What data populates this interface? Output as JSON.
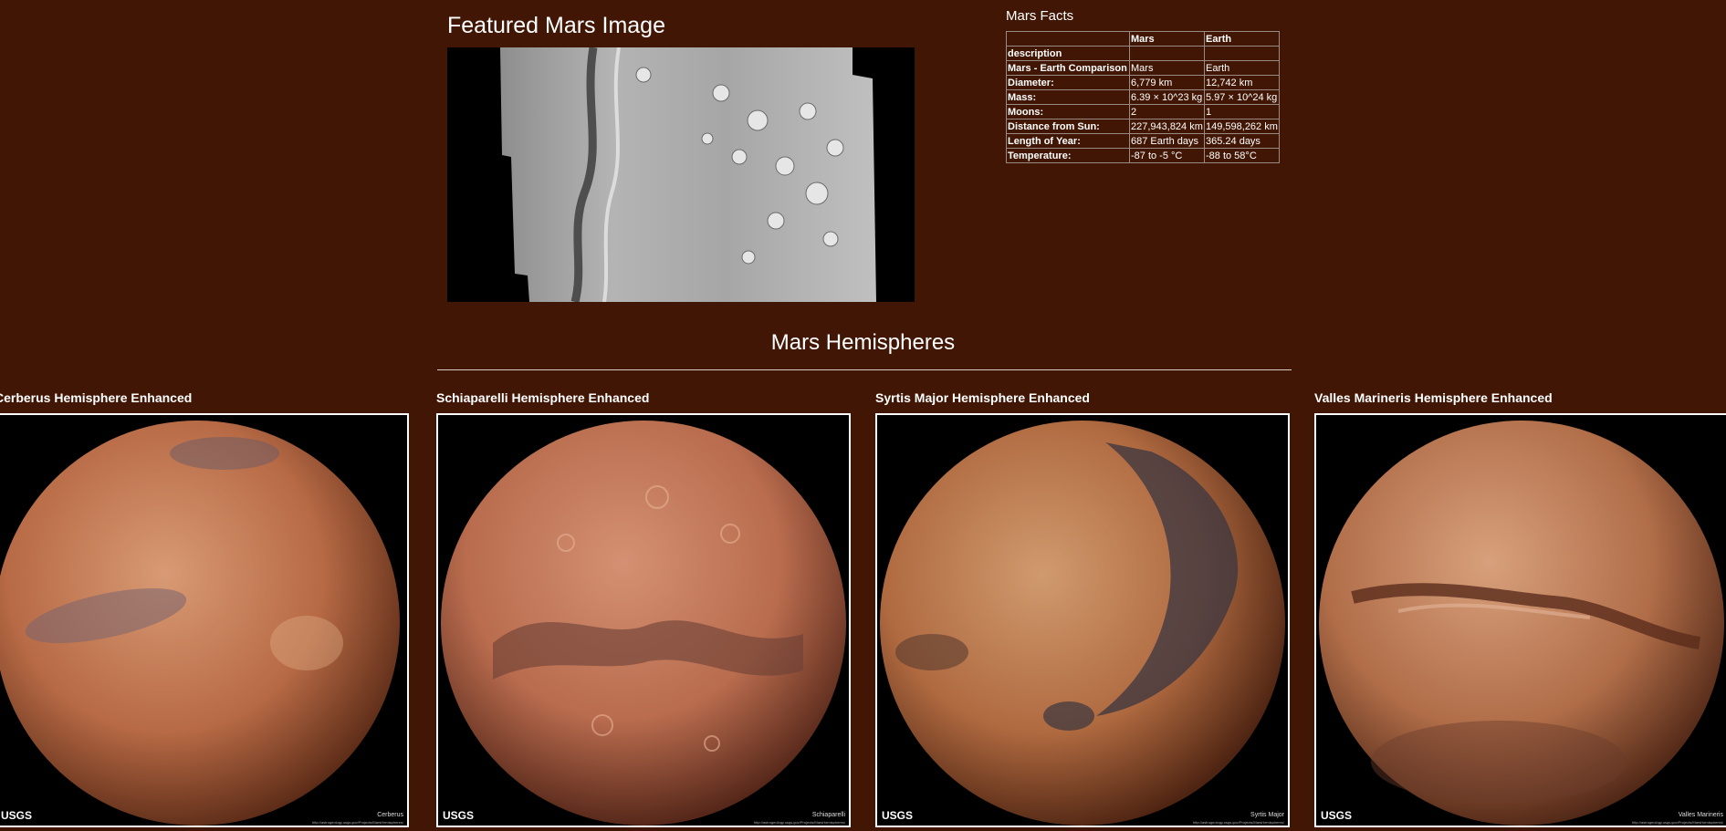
{
  "featured": {
    "title": "Featured Mars Image"
  },
  "facts": {
    "title": "Mars Facts",
    "headers": [
      "",
      "Mars",
      "Earth"
    ],
    "rows": [
      [
        "description",
        "",
        ""
      ],
      [
        "Mars - Earth Comparison",
        "Mars",
        "Earth"
      ],
      [
        "Diameter:",
        "6,779 km",
        "12,742 km"
      ],
      [
        "Mass:",
        "6.39 × 10^23 kg",
        "5.97 × 10^24 kg"
      ],
      [
        "Moons:",
        "2",
        "1"
      ],
      [
        "Distance from Sun:",
        "227,943,824 km",
        "149,598,262 km"
      ],
      [
        "Length of Year:",
        "687 Earth days",
        "365.24 days"
      ],
      [
        "Temperature:",
        "-87 to -5 °C",
        "-88 to 58°C"
      ]
    ]
  },
  "hemispheres": {
    "title": "Mars Hemispheres",
    "items": [
      {
        "name": "Cerberus Hemisphere Enhanced",
        "caption": "Cerberus"
      },
      {
        "name": "Schiaparelli Hemisphere Enhanced",
        "caption": "Schiaparelli"
      },
      {
        "name": "Syrtis Major Hemisphere Enhanced",
        "caption": "Syrtis Major"
      },
      {
        "name": "Valles Marineris Hemisphere Enhanced",
        "caption": "Valles Marineris"
      }
    ],
    "logo_text": "USGS",
    "url_text": "http://astrogeology.usgs.gov/Projects/MarsHemispheres/"
  },
  "colors": {
    "background": "#421604",
    "text": "#ffffff"
  }
}
